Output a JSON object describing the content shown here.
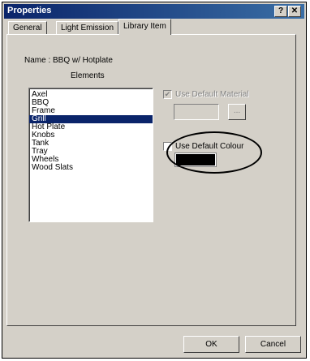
{
  "window": {
    "title": "Properties",
    "help_label": "?",
    "close_label": "✕"
  },
  "tabs": [
    {
      "label": "General"
    },
    {
      "label": "Light Emission"
    },
    {
      "label": "Library Item"
    }
  ],
  "active_tab": "Library Item",
  "library_item": {
    "name_line": "Name :  BBQ w/ Hotplate",
    "elements_label": "Elements",
    "elements": [
      "Axel",
      "BBQ",
      "Frame",
      "Grill",
      "Hot Plate",
      "Knobs",
      "Tank",
      "Tray",
      "Wheels",
      "Wood Slats"
    ],
    "selected_element": "Grill",
    "use_default_material": {
      "label": "Use Default Material",
      "checked": true,
      "enabled": false
    },
    "browse_label": "...",
    "use_default_colour": {
      "label": "Use Default Colour",
      "checked": false,
      "enabled": true
    },
    "colour": "#000000"
  },
  "buttons": {
    "ok_label": "OK",
    "cancel_label": "Cancel"
  }
}
